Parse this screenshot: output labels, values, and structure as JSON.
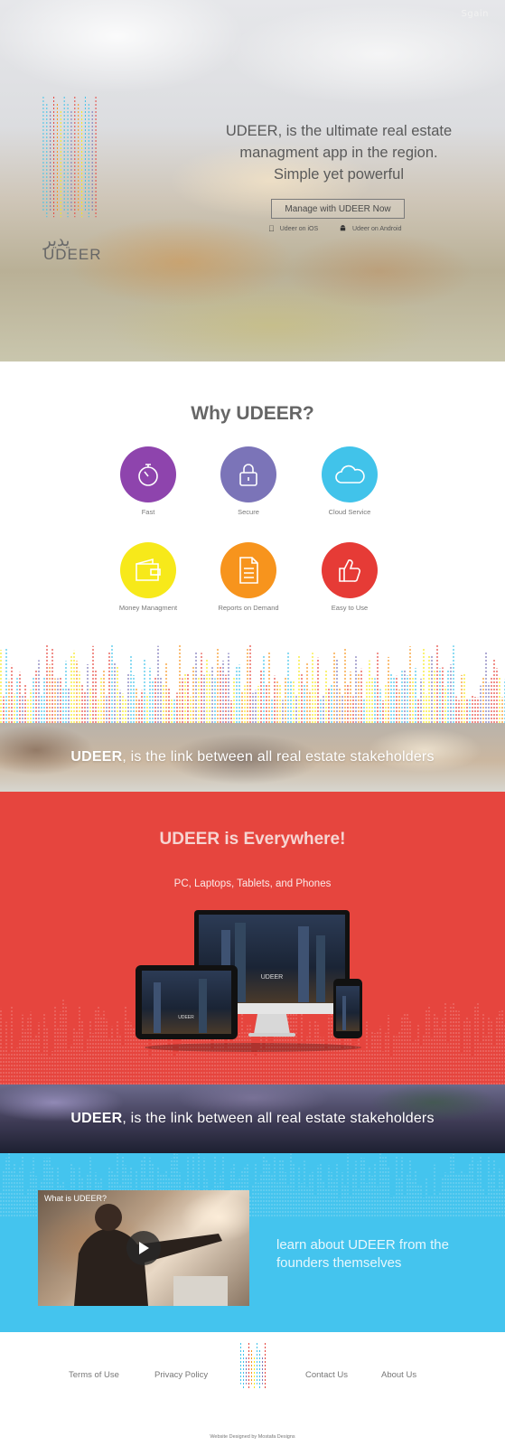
{
  "header": {
    "signin_label": "Sgain"
  },
  "brand": {
    "name_en": "UDEER",
    "name_ar": "يدير"
  },
  "hero": {
    "line1": "UDEER, is the ultimate real estate",
    "line2": "managment app in the region.",
    "line3": "Simple yet powerful",
    "cta_label": "Manage with UDEER Now",
    "ios_label": "Udeer on iOS",
    "android_label": "Udeer on Android"
  },
  "why": {
    "title": "Why UDEER?",
    "features": [
      {
        "label": "Fast",
        "icon": "stopwatch-icon",
        "color": "#8e44ad"
      },
      {
        "label": "Secure",
        "icon": "lock-icon",
        "color": "#7b74b8"
      },
      {
        "label": "Cloud Service",
        "icon": "cloud-icon",
        "color": "#41c3ea"
      },
      {
        "label": "Money Managment",
        "icon": "wallet-icon",
        "color": "#f7e91a"
      },
      {
        "label": "Reports on Demand",
        "icon": "document-icon",
        "color": "#f7941d"
      },
      {
        "label": "Easy to Use",
        "icon": "thumbs-up-icon",
        "color": "#e63b36"
      }
    ]
  },
  "strip1": {
    "brand": "UDEER",
    "text": ", is the link between all real estate stakeholders"
  },
  "everywhere": {
    "title": "UDEER is Everywhere!",
    "subtitle": "PC, Laptops, Tablets, and Phones",
    "device_brand": "UDEER",
    "accent": "#e6453e"
  },
  "strip2": {
    "brand": "UDEER",
    "text": ", is the link between all real estate stakeholders"
  },
  "video_section": {
    "video_title": "What is UDEER?",
    "caption": "learn about UDEER from the founders themselves",
    "accent": "#44c4ee"
  },
  "footer": {
    "links": [
      "Terms of Use",
      "Privacy Policy",
      "Contact Us",
      "About Us"
    ],
    "credit": "Website Designed by Mostafa Designs"
  }
}
